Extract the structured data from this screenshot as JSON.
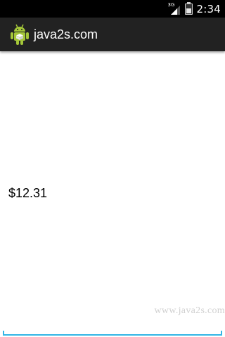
{
  "status_bar": {
    "network_type": "3G",
    "time": "2:34",
    "icons": [
      "signal-icon",
      "battery-icon"
    ]
  },
  "action_bar": {
    "title": "java2s.com",
    "icon": "android-app-icon"
  },
  "content": {
    "price_text": "$12.31",
    "watermark": "www.java2s.com"
  },
  "colors": {
    "status_bar": "#000000",
    "action_bar": "#222222",
    "background": "#ffffff",
    "accent": "#33b5e5",
    "android_green": "#a4c639"
  }
}
